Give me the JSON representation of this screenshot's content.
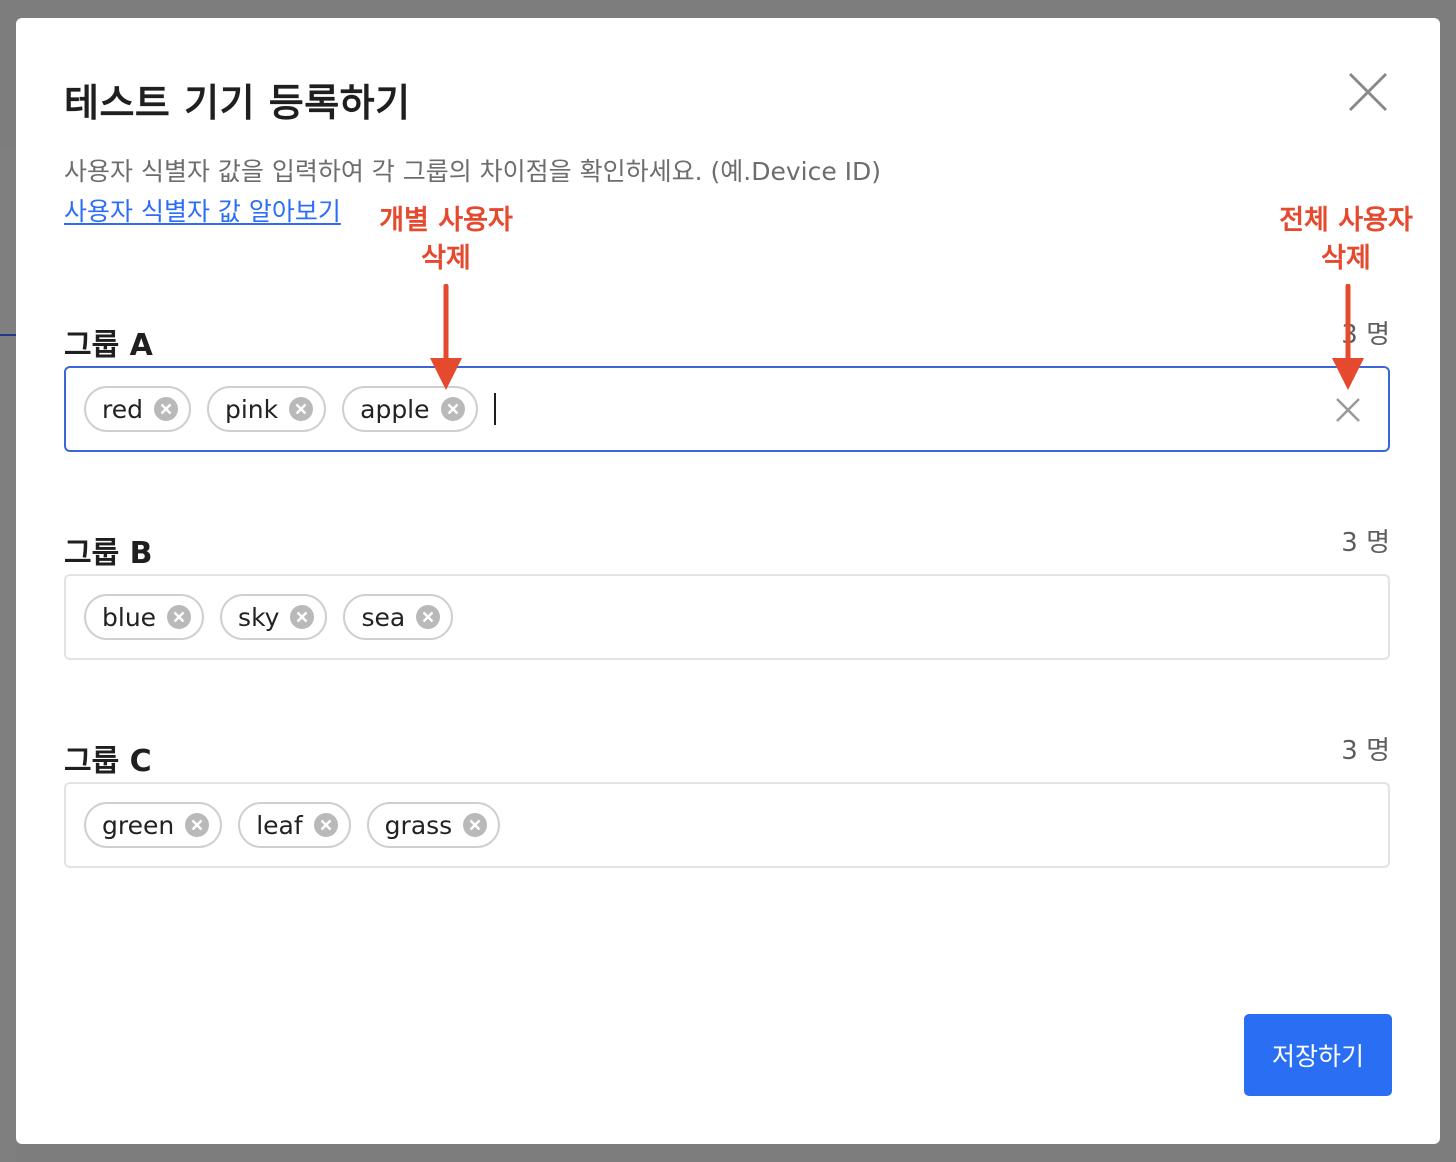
{
  "modal": {
    "title": "테스트 기기 등록하기",
    "description": "사용자 식별자 값을 입력하여 각 그룹의 차이점을 확인하세요. (예.Device ID)",
    "help_link": "사용자 식별자 값 알아보기",
    "save_label": "저장하기"
  },
  "groups": [
    {
      "label": "그룹 A",
      "count": "3 명",
      "tags": [
        "red",
        "pink",
        "apple"
      ]
    },
    {
      "label": "그룹 B",
      "count": "3 명",
      "tags": [
        "blue",
        "sky",
        "sea"
      ]
    },
    {
      "label": "그룹 C",
      "count": "3 명",
      "tags": [
        "green",
        "leaf",
        "grass"
      ]
    }
  ],
  "annotations": {
    "individual_delete": {
      "line1": "개별 사용자",
      "line2": "삭제"
    },
    "all_delete": {
      "line1": "전체 사용자",
      "line2": "삭제"
    }
  },
  "colors": {
    "accent": "#2a6ff3",
    "annotation": "#e64a2e",
    "focus_border": "#3b67d6"
  },
  "icons": {
    "close": "close-icon",
    "chip_remove": "circle-x-icon",
    "clear_all": "x-icon"
  }
}
